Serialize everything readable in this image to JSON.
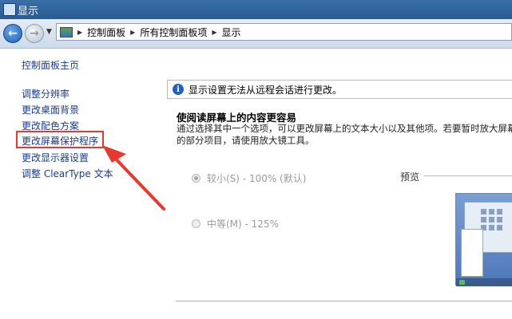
{
  "window": {
    "title": "显示"
  },
  "address_bar": {
    "crumbs": [
      "控制面板",
      "所有控制面板项",
      "显示"
    ]
  },
  "sidebar": {
    "home_link": "控制面板主页",
    "items": [
      {
        "label": "调整分辨率"
      },
      {
        "label": "更改桌面背景"
      },
      {
        "label": "更改配色方案"
      },
      {
        "label": "更改屏幕保护程序"
      },
      {
        "label": "更改显示器设置"
      },
      {
        "label": "调整 ClearType 文本"
      }
    ]
  },
  "main": {
    "info_message": "显示设置无法从远程会话进行更改。",
    "heading": "使阅读屏幕上的内容更容易",
    "description": "通过选择其中一个选项，可以更改屏幕上的文本大小以及其他项。若要暂时放大屏幕上的部分项目，请使用放大镜工具。",
    "options": [
      {
        "label": "较小(S) - 100% (默认)",
        "checked": true
      },
      {
        "label": "中等(M) - 125%",
        "checked": false
      }
    ],
    "preview_label": "预览"
  },
  "annotation": {
    "highlight_color": "#e8382f"
  }
}
